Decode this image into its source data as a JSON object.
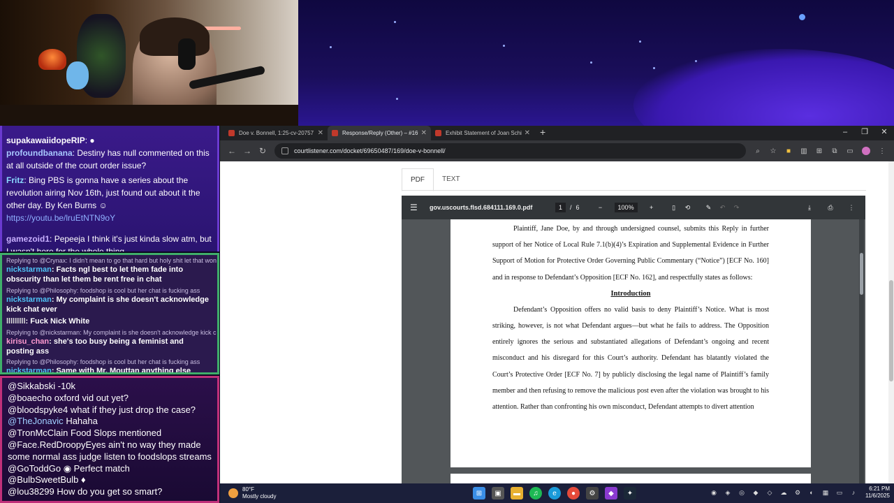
{
  "chat_top": [
    {
      "user": "supakawaiidopeRIP",
      "color": "#ffffff",
      "text": ""
    },
    {
      "user": "profoundbanana",
      "color": "#a8c8ff",
      "text": "Destiny has null commented on this at all outside of the court order issue?"
    },
    {
      "user": "Fritz",
      "color": "#8ad8ff",
      "text": "Bing PBS is gonna have a series about the revolution airing Nov 16th, just found out about it the other day. By Ken Burns",
      "link": "https://youtu.be/lruEtNTN9oY"
    },
    {
      "user": "gamezoid1",
      "color": "#c8b0ff",
      "text": "Pepeeja I think it's just kinda slow atm, but I wasn't here for the whole thing"
    }
  ],
  "chat_mid": [
    {
      "reply": "Replying to @Crynax: I didn't mean to go that hard but holy shit let that won",
      "user": "nickstarman",
      "text": "Facts ngl best to let them fade into obscurity than let them be rent free in chat"
    },
    {
      "reply": "Replying to @Philosophy: foodshop is cool but her chat is fucking ass",
      "user": "nickstarman",
      "text": "My complaint is she doesn't acknowledge kick chat ever"
    },
    {
      "reply": "",
      "user": "lllllllll",
      "text": "Fuck Nick White"
    },
    {
      "reply": "Replying to @nickstarman: My complaint is she doesn't acknowledge kick c",
      "user": "kirisu_chan",
      "text": "she's too busy being a feminist and posting ass"
    },
    {
      "reply": "Replying to @Philosophy: foodshop is cool but her chat is fucking ass",
      "user": "nickstarman",
      "text": "Same with Mr. Mouttan anything else"
    }
  ],
  "chat_bot": [
    {
      "user": "@Sikkabski",
      "text": "-10k"
    },
    {
      "user": "@boaecho",
      "text": "oxford vid out yet?"
    },
    {
      "user": "@bloodspyke4",
      "text": "what if they just drop the case?"
    },
    {
      "user": "@TheJonavic",
      "text": "Hahaha"
    },
    {
      "user": "@TronMcClain",
      "text": "Food Slops mentioned"
    },
    {
      "user": "@Face.RedDroopyEyes",
      "text": "ain't no way they made some normal ass judge listen to foodslops streams"
    },
    {
      "user": "@GoToddGo",
      "text": "Perfect match"
    },
    {
      "user": "@BulbSweetBulb",
      "text": ""
    },
    {
      "user": "@lou38299",
      "text": "How do you get so smart?"
    }
  ],
  "browser": {
    "tabs": [
      {
        "title": "Doe v. Bonnell, 1:25-cv-20757",
        "active": false
      },
      {
        "title": "Response/Reply (Other) – #169",
        "active": true
      },
      {
        "title": "Exhibit Statement of Joan Schi",
        "active": false
      }
    ],
    "url": "courtlistener.com/docket/69650487/169/doe-v-bonnell/",
    "view_tabs": [
      "PDF",
      "TEXT"
    ],
    "pdf": {
      "filename": "gov.uscourts.flsd.684111.169.0.pdf",
      "page": "1",
      "pages": "6",
      "zoom": "100%",
      "para1": "Plaintiff, Jane Doe, by and through undersigned counsel, submits this Reply in further support of her Notice of Local Rule 7.1(b)(4)’s Expiration and Supplemental Evidence in Further Support of Motion for Protective Order Governing Public Commentary (“Notice”) [ECF No. 160] and in response to Defendant’s Opposition [ECF No. 162], and respectfully states as follows:",
      "heading": "Introduction",
      "para2": "Defendant’s Opposition offers no valid basis to deny Plaintiff’s Notice. What is most striking, however, is not what Defendant argues—but what he fails to address. The Opposition entirely ignores the serious and substantiated allegations of Defendant’s ongoing and recent misconduct and his disregard for this Court’s authority. Defendant has blatantly violated the Court’s Protective Order [ECF No. 7] by publicly disclosing the legal name of Plaintiff’s family member and then refusing to remove the malicious post even after the violation was brought to his attention. Rather than confronting his own misconduct, Defendant attempts to divert attention"
    }
  },
  "taskbar": {
    "temp": "80°F",
    "weather": "Mostly cloudy",
    "time": "6:21 PM",
    "date": "11/6/2025"
  }
}
